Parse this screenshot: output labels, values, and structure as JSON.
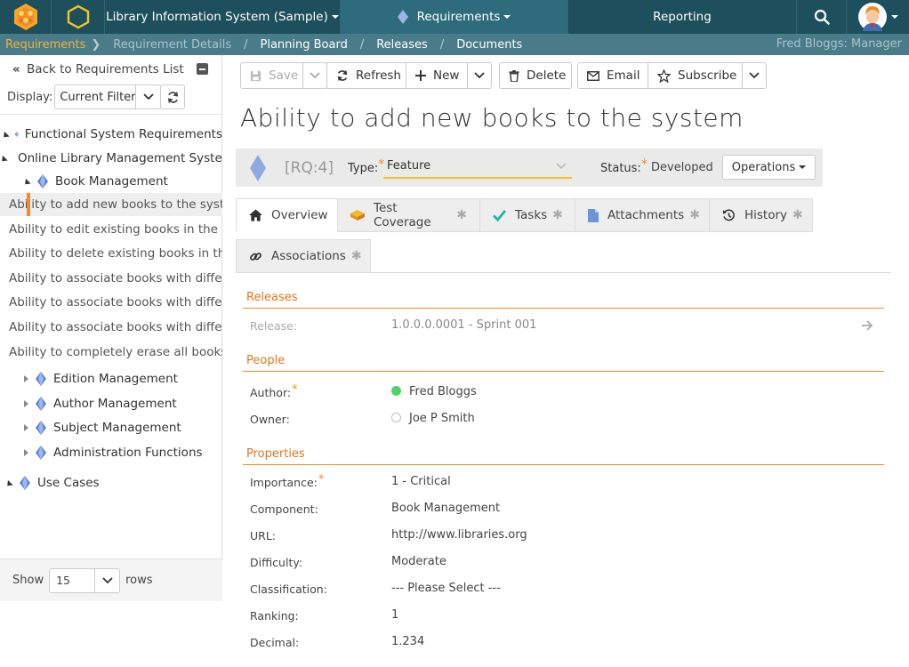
{
  "topbar": {
    "project": "Library Information System (Sample)",
    "module": "Requirements",
    "reporting": "Reporting"
  },
  "breadcrumb": {
    "items": [
      "Requirements",
      "Requirement Details",
      "Planning Board",
      "Releases",
      "Documents"
    ],
    "user": "Fred Bloggs: Manager"
  },
  "sidebar": {
    "back": "Back to Requirements List",
    "display_label": "Display:",
    "display_value": "Current Filter",
    "tree": [
      "Functional System Requirements",
      "Online Library Management System",
      "Book Management",
      "Ability to add new books to the system",
      "Ability to edit existing books in the system",
      "Ability to delete existing books in the system",
      "Ability to associate books with different subjects",
      "Ability to associate books with different authors",
      "Ability to associate books with different editions",
      "Ability to completely erase all books",
      "Edition Management",
      "Author Management",
      "Subject Management",
      "Administration Functions",
      "Use Cases"
    ],
    "show_label": "Show",
    "rows_value": "15",
    "rows_label": "rows"
  },
  "toolbar": {
    "save": "Save",
    "refresh": "Refresh",
    "new": "New",
    "delete": "Delete",
    "email": "Email",
    "subscribe": "Subscribe"
  },
  "requirement": {
    "title": "Ability to add new books to the system",
    "id": "[RQ:4]",
    "type_label": "Type:",
    "type_value": "Feature",
    "status_label": "Status:",
    "status_value": "Developed",
    "operations": "Operations"
  },
  "tabs": [
    "Overview",
    "Test Coverage",
    "Tasks",
    "Attachments",
    "History",
    "Associations"
  ],
  "sections": {
    "releases": "Releases",
    "people": "People",
    "properties": "Properties"
  },
  "fields": {
    "release_label": "Release:",
    "release_value": "1.0.0.0.0001 - Sprint 001",
    "author_label": "Author:",
    "author_value": "Fred Bloggs",
    "owner_label": "Owner:",
    "owner_value": "Joe P Smith",
    "importance_label": "Importance:",
    "importance_value": "1 - Critical",
    "component_label": "Component:",
    "component_value": "Book Management",
    "url_label": "URL:",
    "url_value": "http://www.libraries.org",
    "difficulty_label": "Difficulty:",
    "difficulty_value": "Moderate",
    "classification_label": "Classification:",
    "classification_value": "--- Please Select ---",
    "ranking_label": "Ranking:",
    "ranking_value": "1",
    "decimal_label": "Decimal:",
    "decimal_value": "1.234"
  },
  "colors": {
    "topbar": "#1e4f5c",
    "crumbbar": "#4a7b88",
    "accent_orange": "#f08c2e",
    "breadcrumb_active": "#f2b33d",
    "type_underline": "#f2c230"
  }
}
